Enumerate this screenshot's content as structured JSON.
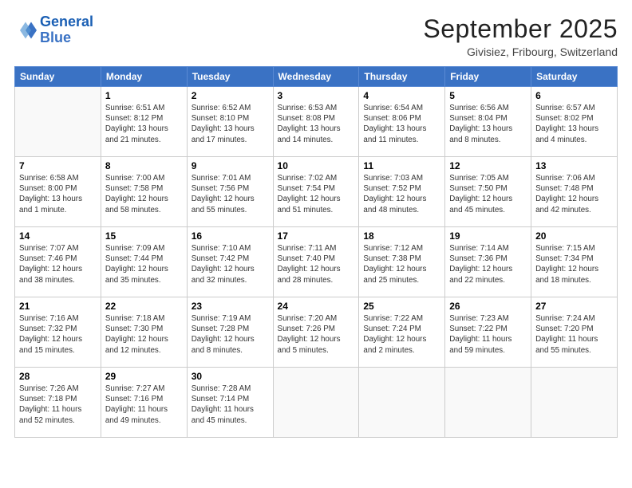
{
  "header": {
    "logo_line1": "General",
    "logo_line2": "Blue",
    "month": "September 2025",
    "location": "Givisiez, Fribourg, Switzerland"
  },
  "days_of_week": [
    "Sunday",
    "Monday",
    "Tuesday",
    "Wednesday",
    "Thursday",
    "Friday",
    "Saturday"
  ],
  "weeks": [
    [
      {
        "day": "",
        "info": ""
      },
      {
        "day": "1",
        "info": "Sunrise: 6:51 AM\nSunset: 8:12 PM\nDaylight: 13 hours\nand 21 minutes."
      },
      {
        "day": "2",
        "info": "Sunrise: 6:52 AM\nSunset: 8:10 PM\nDaylight: 13 hours\nand 17 minutes."
      },
      {
        "day": "3",
        "info": "Sunrise: 6:53 AM\nSunset: 8:08 PM\nDaylight: 13 hours\nand 14 minutes."
      },
      {
        "day": "4",
        "info": "Sunrise: 6:54 AM\nSunset: 8:06 PM\nDaylight: 13 hours\nand 11 minutes."
      },
      {
        "day": "5",
        "info": "Sunrise: 6:56 AM\nSunset: 8:04 PM\nDaylight: 13 hours\nand 8 minutes."
      },
      {
        "day": "6",
        "info": "Sunrise: 6:57 AM\nSunset: 8:02 PM\nDaylight: 13 hours\nand 4 minutes."
      }
    ],
    [
      {
        "day": "7",
        "info": "Sunrise: 6:58 AM\nSunset: 8:00 PM\nDaylight: 13 hours\nand 1 minute."
      },
      {
        "day": "8",
        "info": "Sunrise: 7:00 AM\nSunset: 7:58 PM\nDaylight: 12 hours\nand 58 minutes."
      },
      {
        "day": "9",
        "info": "Sunrise: 7:01 AM\nSunset: 7:56 PM\nDaylight: 12 hours\nand 55 minutes."
      },
      {
        "day": "10",
        "info": "Sunrise: 7:02 AM\nSunset: 7:54 PM\nDaylight: 12 hours\nand 51 minutes."
      },
      {
        "day": "11",
        "info": "Sunrise: 7:03 AM\nSunset: 7:52 PM\nDaylight: 12 hours\nand 48 minutes."
      },
      {
        "day": "12",
        "info": "Sunrise: 7:05 AM\nSunset: 7:50 PM\nDaylight: 12 hours\nand 45 minutes."
      },
      {
        "day": "13",
        "info": "Sunrise: 7:06 AM\nSunset: 7:48 PM\nDaylight: 12 hours\nand 42 minutes."
      }
    ],
    [
      {
        "day": "14",
        "info": "Sunrise: 7:07 AM\nSunset: 7:46 PM\nDaylight: 12 hours\nand 38 minutes."
      },
      {
        "day": "15",
        "info": "Sunrise: 7:09 AM\nSunset: 7:44 PM\nDaylight: 12 hours\nand 35 minutes."
      },
      {
        "day": "16",
        "info": "Sunrise: 7:10 AM\nSunset: 7:42 PM\nDaylight: 12 hours\nand 32 minutes."
      },
      {
        "day": "17",
        "info": "Sunrise: 7:11 AM\nSunset: 7:40 PM\nDaylight: 12 hours\nand 28 minutes."
      },
      {
        "day": "18",
        "info": "Sunrise: 7:12 AM\nSunset: 7:38 PM\nDaylight: 12 hours\nand 25 minutes."
      },
      {
        "day": "19",
        "info": "Sunrise: 7:14 AM\nSunset: 7:36 PM\nDaylight: 12 hours\nand 22 minutes."
      },
      {
        "day": "20",
        "info": "Sunrise: 7:15 AM\nSunset: 7:34 PM\nDaylight: 12 hours\nand 18 minutes."
      }
    ],
    [
      {
        "day": "21",
        "info": "Sunrise: 7:16 AM\nSunset: 7:32 PM\nDaylight: 12 hours\nand 15 minutes."
      },
      {
        "day": "22",
        "info": "Sunrise: 7:18 AM\nSunset: 7:30 PM\nDaylight: 12 hours\nand 12 minutes."
      },
      {
        "day": "23",
        "info": "Sunrise: 7:19 AM\nSunset: 7:28 PM\nDaylight: 12 hours\nand 8 minutes."
      },
      {
        "day": "24",
        "info": "Sunrise: 7:20 AM\nSunset: 7:26 PM\nDaylight: 12 hours\nand 5 minutes."
      },
      {
        "day": "25",
        "info": "Sunrise: 7:22 AM\nSunset: 7:24 PM\nDaylight: 12 hours\nand 2 minutes."
      },
      {
        "day": "26",
        "info": "Sunrise: 7:23 AM\nSunset: 7:22 PM\nDaylight: 11 hours\nand 59 minutes."
      },
      {
        "day": "27",
        "info": "Sunrise: 7:24 AM\nSunset: 7:20 PM\nDaylight: 11 hours\nand 55 minutes."
      }
    ],
    [
      {
        "day": "28",
        "info": "Sunrise: 7:26 AM\nSunset: 7:18 PM\nDaylight: 11 hours\nand 52 minutes."
      },
      {
        "day": "29",
        "info": "Sunrise: 7:27 AM\nSunset: 7:16 PM\nDaylight: 11 hours\nand 49 minutes."
      },
      {
        "day": "30",
        "info": "Sunrise: 7:28 AM\nSunset: 7:14 PM\nDaylight: 11 hours\nand 45 minutes."
      },
      {
        "day": "",
        "info": ""
      },
      {
        "day": "",
        "info": ""
      },
      {
        "day": "",
        "info": ""
      },
      {
        "day": "",
        "info": ""
      }
    ]
  ]
}
